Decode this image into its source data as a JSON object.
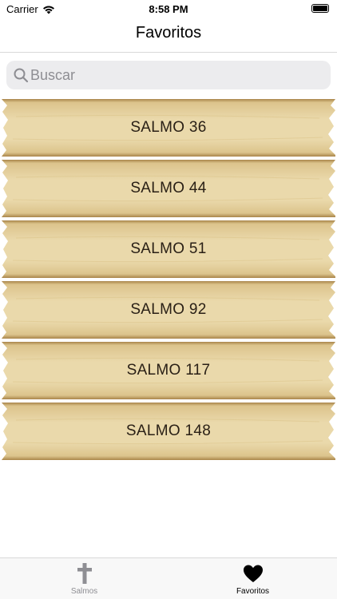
{
  "status_bar": {
    "carrier": "Carrier",
    "time": "8:58 PM",
    "icons": [
      "wifi-icon",
      "battery-icon"
    ]
  },
  "nav": {
    "title": "Favoritos"
  },
  "search": {
    "placeholder": "Buscar",
    "value": "",
    "icon": "search-icon"
  },
  "favorites": [
    {
      "label": "SALMO 36"
    },
    {
      "label": "SALMO 44"
    },
    {
      "label": "SALMO 51"
    },
    {
      "label": "SALMO 92"
    },
    {
      "label": "SALMO 117"
    },
    {
      "label": "SALMO 148"
    }
  ],
  "tab_bar": {
    "tabs": [
      {
        "label": "Salmos",
        "icon": "cross-icon",
        "active": false
      },
      {
        "label": "Favoritos",
        "icon": "heart-icon",
        "active": true
      }
    ]
  },
  "colors": {
    "wood_light": "#ead9ab",
    "wood_mid": "#dcc48c",
    "wood_dark": "#a9854a",
    "tab_active": "#000000",
    "tab_inactive": "#8e8e93"
  }
}
